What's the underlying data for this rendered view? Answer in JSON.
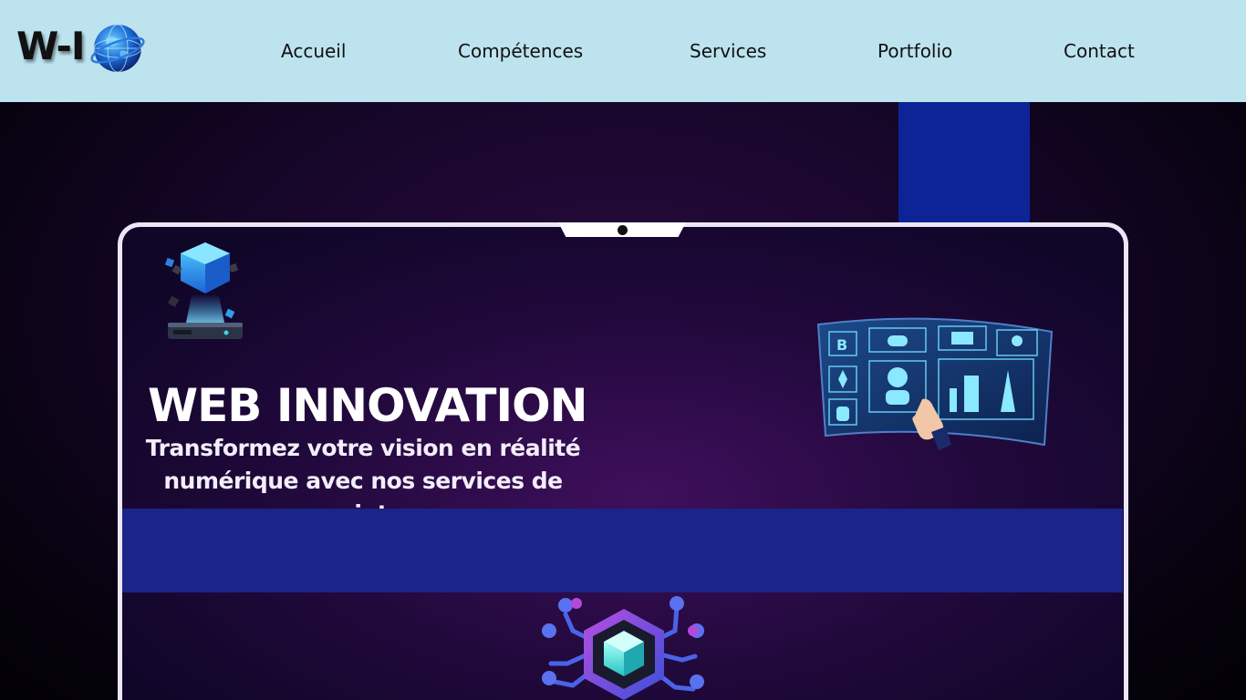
{
  "logo": {
    "text": "W-I",
    "icon": "globe-icon"
  },
  "nav": {
    "items": [
      {
        "label": "Accueil"
      },
      {
        "label": "Compétences"
      },
      {
        "label": "Services"
      },
      {
        "label": "Portfolio"
      },
      {
        "label": "Contact"
      }
    ]
  },
  "hero": {
    "title": "WEB INNOVATION",
    "subtitle_line1": "Transformez votre vision en réalité",
    "subtitle_line2": "numérique avec nos services de pointe"
  },
  "illustrations": {
    "top_left": "hologram-cube-icon",
    "right": "interactive-screen-icon",
    "bottom": "hexagon-cube-network-icon"
  },
  "colors": {
    "header_bg": "#bde3ef",
    "band": "#1b2488",
    "strip": "#0c2496",
    "accent_cyan": "#3fd6e6"
  }
}
